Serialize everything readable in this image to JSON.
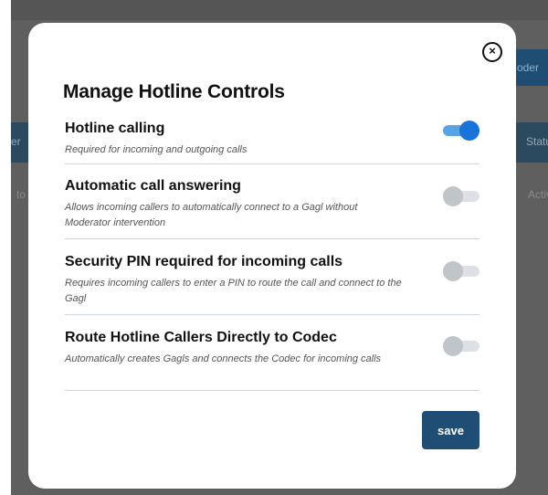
{
  "background": {
    "button_fragment": "oder",
    "header_left": "er",
    "header_right": "Status",
    "row_left": "to",
    "row_right": "Active"
  },
  "modal": {
    "title": "Manage Hotline Controls",
    "close_symbol": "×",
    "settings": [
      {
        "name": "Hotline calling",
        "description": "Required for incoming and outgoing calls",
        "enabled": true
      },
      {
        "name": "Automatic call answering",
        "description": "Allows incoming callers to automatically connect to a Gagl without Moderator intervention",
        "enabled": false
      },
      {
        "name": "Security PIN required for incoming calls",
        "description": "Requires incoming callers to enter a PIN to route the call and connect to the Gagl",
        "enabled": false
      },
      {
        "name": "Route Hotline Callers Directly to Codec",
        "description": "Automatically creates Gagls and connects the Codec for incoming calls",
        "enabled": false
      }
    ],
    "save_label": "save"
  },
  "colors": {
    "toggle_on": "#1a73d9",
    "toggle_off": "#c0c5ca",
    "save_button": "#1f4d73"
  }
}
